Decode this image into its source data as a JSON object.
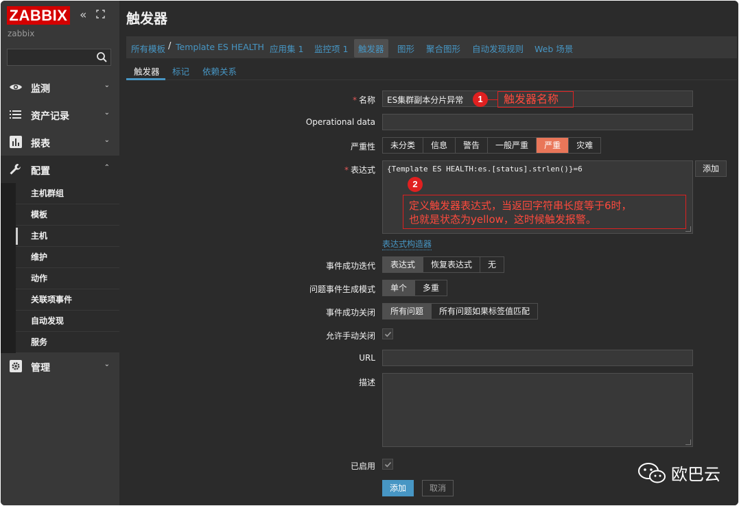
{
  "app": {
    "logo": "ZABBIX",
    "server_name": "zabbix"
  },
  "sidebar": {
    "search": {
      "value": "",
      "placeholder": ""
    },
    "menu": [
      {
        "label": "监测",
        "icon": "eye-icon",
        "chevron": "⌄"
      },
      {
        "label": "资产记录",
        "icon": "list-icon",
        "chevron": "⌄"
      },
      {
        "label": "报表",
        "icon": "bar-chart-icon",
        "chevron": "⌄"
      },
      {
        "label": "配置",
        "icon": "wrench-icon",
        "chevron": "⌃"
      },
      {
        "label": "管理",
        "icon": "gear-icon",
        "chevron": "⌄"
      }
    ],
    "config_submenu": [
      "主机群组",
      "模板",
      "主机",
      "维护",
      "动作",
      "关联项事件",
      "自动发现",
      "服务"
    ],
    "selected_submenu": "主机"
  },
  "page": {
    "title": "触发器"
  },
  "breadcrumb": {
    "all_templates": "所有模板",
    "separator": "/",
    "template": "Template ES HEALTH",
    "applications": "应用集 1",
    "items": "监控项 1",
    "triggers": "触发器",
    "graphs": "图形",
    "screens": "聚合图形",
    "discovery": "自动发现规则",
    "web": "Web 场景"
  },
  "tabs": {
    "trigger": "触发器",
    "tags": "标记",
    "dependencies": "依赖关系"
  },
  "form": {
    "name_label": "名称",
    "name_value": "ES集群副本分片异常",
    "opdata_label": "Operational data",
    "opdata_value": "",
    "severity_label": "严重性",
    "severity_options": [
      "未分类",
      "信息",
      "警告",
      "一般严重",
      "严重",
      "灾难"
    ],
    "severity_selected": "严重",
    "expression_label": "表达式",
    "expression_value": "{Template ES HEALTH:es.[status].strlen()}=6",
    "expression_add_button": "添加",
    "expression_constructor": "表达式构造器",
    "ok_event_gen_label": "事件成功迭代",
    "ok_event_gen_options": [
      "表达式",
      "恢复表达式",
      "无"
    ],
    "ok_event_gen_selected": "表达式",
    "problem_mode_label": "问题事件生成模式",
    "problem_mode_options": [
      "单个",
      "多重"
    ],
    "problem_mode_selected": "单个",
    "ok_close_label": "事件成功关闭",
    "ok_close_options": [
      "所有问题",
      "所有问题如果标签值匹配"
    ],
    "ok_close_selected": "所有问题",
    "manual_close_label": "允许手动关闭",
    "manual_close_checked": true,
    "url_label": "URL",
    "url_value": "",
    "description_label": "描述",
    "description_value": "",
    "enabled_label": "已启用",
    "enabled_checked": true,
    "add_button": "添加",
    "cancel_button": "取消"
  },
  "annotations": {
    "marker_1": "1",
    "note_1": "触发器名称",
    "marker_2": "2",
    "note_2_line1": "定义触发器表达式，当返回字符串长度等于6时，",
    "note_2_line2": "也就是状态为yellow，这时候触发报警。"
  },
  "watermark": {
    "text": "欧巴云"
  },
  "colors": {
    "accent": "#4796c4",
    "severity_high": "#e97659",
    "logo_red": "#d40000",
    "annotation_red": "#e02020"
  }
}
